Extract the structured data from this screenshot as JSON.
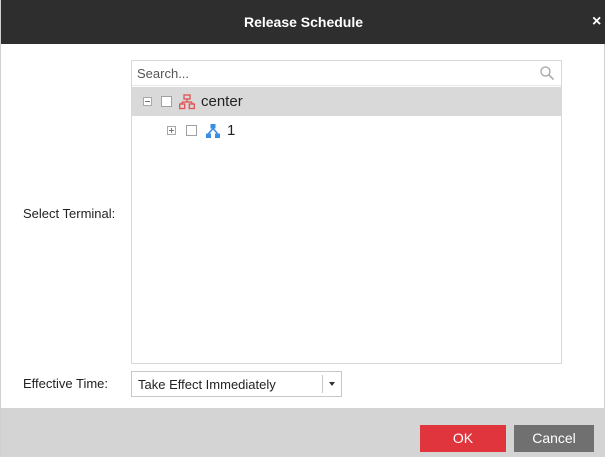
{
  "dialog": {
    "title": "Release Schedule",
    "close_glyph": "×"
  },
  "terminal": {
    "label": "Select Terminal:",
    "search_placeholder": "Search...",
    "tree": [
      {
        "label": "center",
        "icon": "organization-icon",
        "selected": true,
        "checked": false,
        "expander": "collapse"
      },
      {
        "label": "1",
        "icon": "network-node-icon",
        "selected": false,
        "checked": false,
        "expander": "expand"
      }
    ]
  },
  "effective_time": {
    "label": "Effective Time:",
    "value": "Take Effect Immediately"
  },
  "footer": {
    "ok_label": "OK",
    "cancel_label": "Cancel"
  },
  "colors": {
    "titlebar": "#2e2e2e",
    "ok_button": "#e0353d",
    "cancel_button": "#707070",
    "selected_row": "#d9d9d9",
    "org_icon": "#e05050",
    "node_icon": "#3a8ee6"
  }
}
